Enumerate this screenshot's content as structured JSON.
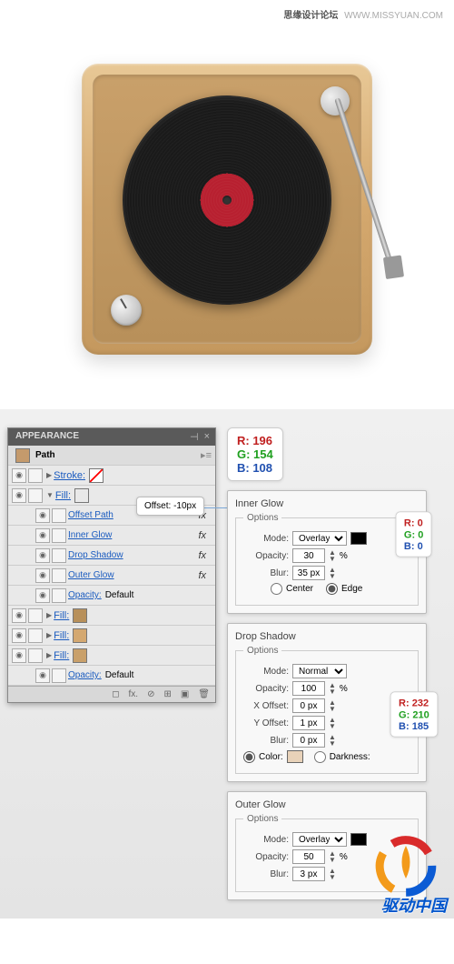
{
  "watermark": {
    "chinese": "思缘设计论坛",
    "url": "WWW.MISSYUAN.COM"
  },
  "appearance": {
    "title": "APPEARANCE",
    "path_label": "Path",
    "stroke_label": "Stroke:",
    "fill_label": "Fill:",
    "opacity_label": "Opacity:",
    "opacity_value": "Default",
    "effects": {
      "offset_path": "Offset Path",
      "inner_glow": "Inner Glow",
      "drop_shadow": "Drop Shadow",
      "outer_glow": "Outer Glow"
    },
    "swatches": {
      "stroke": "none",
      "fill1": "#c49a6c",
      "fill2": "#b8905a",
      "fill3": "#d4a870",
      "fill4": "#c9a06a"
    },
    "fx_symbol": "fx"
  },
  "offset_callout": {
    "label": "Offset:",
    "value": "-10px"
  },
  "rgb1": {
    "r": "R: 196",
    "g": "G: 154",
    "b": "B: 108"
  },
  "rgb2": {
    "r": "R: 0",
    "g": "G: 0",
    "b": "B: 0"
  },
  "rgb3": {
    "r": "R: 232",
    "g": "G: 210",
    "b": "B: 185"
  },
  "inner_glow": {
    "title": "Inner Glow",
    "options": "Options",
    "mode_label": "Mode:",
    "mode_value": "Overlay",
    "opacity_label": "Opacity:",
    "opacity_value": "30",
    "percent": "%",
    "blur_label": "Blur:",
    "blur_value": "35 px",
    "center": "Center",
    "edge": "Edge",
    "swatch": "#000000"
  },
  "drop_shadow": {
    "title": "Drop Shadow",
    "options": "Options",
    "mode_label": "Mode:",
    "mode_value": "Normal",
    "opacity_label": "Opacity:",
    "opacity_value": "100",
    "percent": "%",
    "x_label": "X Offset:",
    "x_value": "0 px",
    "y_label": "Y Offset:",
    "y_value": "1 px",
    "blur_label": "Blur:",
    "blur_value": "0 px",
    "color_label": "Color:",
    "darkness_label": "Darkness:",
    "swatch": "#e8d2b9"
  },
  "outer_glow": {
    "title": "Outer Glow",
    "options": "Options",
    "mode_label": "Mode:",
    "mode_value": "Overlay",
    "opacity_label": "Opacity:",
    "opacity_value": "50",
    "percent": "%",
    "blur_label": "Blur:",
    "blur_value": "3 px",
    "swatch": "#000000"
  },
  "brand": "驱动中国"
}
